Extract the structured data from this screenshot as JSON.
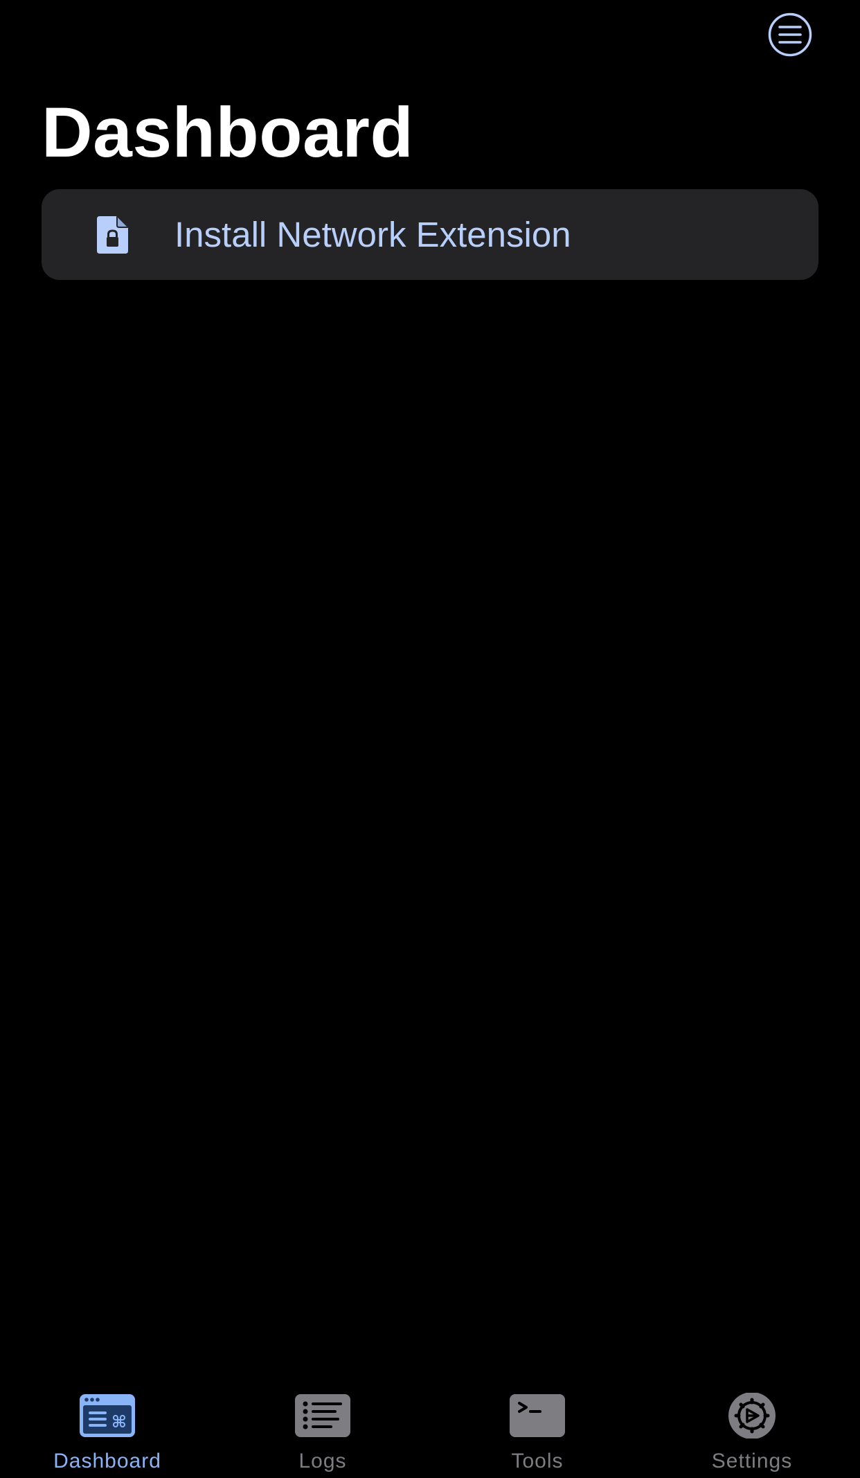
{
  "header": {
    "menu_icon": "list-circle-icon",
    "title": "Dashboard"
  },
  "actions": [
    {
      "icon": "lock-document-icon",
      "label": "Install Network Extension"
    }
  ],
  "tab_bar": {
    "active": "Dashboard",
    "tabs": [
      {
        "label": "Dashboard",
        "icon": "dashboard-window-icon"
      },
      {
        "label": "Logs",
        "icon": "list-bullet-icon"
      },
      {
        "label": "Tools",
        "icon": "terminal-icon"
      },
      {
        "label": "Settings",
        "icon": "gear-icon"
      }
    ]
  },
  "colors": {
    "background": "#000000",
    "accent": "#8ab4f8",
    "card": "#242426",
    "inactive_tab": "#7d7d82"
  }
}
